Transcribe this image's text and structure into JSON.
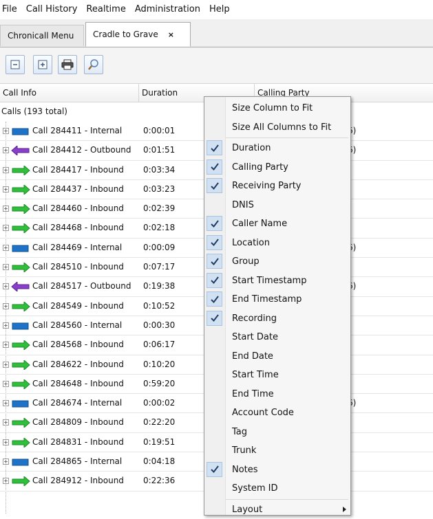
{
  "menubar": [
    "File",
    "Call History",
    "Realtime",
    "Administration",
    "Help"
  ],
  "tabs": [
    {
      "label": "Chronicall Menu",
      "active": false
    },
    {
      "label": "Cradle to Grave",
      "active": true,
      "close": "×"
    }
  ],
  "toolbar": {
    "buttons": [
      "collapse-all-icon",
      "expand-all-icon",
      "print-icon",
      "search-icon"
    ]
  },
  "grid": {
    "columns": [
      "Call Info",
      "Duration",
      "Calling Party"
    ],
    "group_label": "Calls (193 total)",
    "rows": [
      {
        "info": "Call 284411 - Internal",
        "duration": "0:00:01",
        "type": "internal",
        "calling": "6)"
      },
      {
        "info": "Call 284412 - Outbound",
        "duration": "0:01:51",
        "type": "outbound",
        "calling": "6)"
      },
      {
        "info": "Call 284417 - Inbound",
        "duration": "0:03:34",
        "type": "inbound",
        "calling": ""
      },
      {
        "info": "Call 284437 - Inbound",
        "duration": "0:03:23",
        "type": "inbound",
        "calling": ""
      },
      {
        "info": "Call 284460 - Inbound",
        "duration": "0:02:39",
        "type": "inbound",
        "calling": ""
      },
      {
        "info": "Call 284468 - Inbound",
        "duration": "0:02:18",
        "type": "inbound",
        "calling": ""
      },
      {
        "info": "Call 284469 - Internal",
        "duration": "0:00:09",
        "type": "internal",
        "calling": "6)"
      },
      {
        "info": "Call 284510 - Inbound",
        "duration": "0:07:17",
        "type": "inbound",
        "calling": ""
      },
      {
        "info": "Call 284517 - Outbound",
        "duration": "0:19:38",
        "type": "outbound",
        "calling": "6)"
      },
      {
        "info": "Call 284549 - Inbound",
        "duration": "0:10:52",
        "type": "inbound",
        "calling": ""
      },
      {
        "info": "Call 284560 - Internal",
        "duration": "0:00:30",
        "type": "internal",
        "calling": ")"
      },
      {
        "info": "Call 284568 - Inbound",
        "duration": "0:06:17",
        "type": "inbound",
        "calling": ""
      },
      {
        "info": "Call 284622 - Inbound",
        "duration": "0:10:20",
        "type": "inbound",
        "calling": ""
      },
      {
        "info": "Call 284648 - Inbound",
        "duration": "0:59:20",
        "type": "inbound",
        "calling": ""
      },
      {
        "info": "Call 284674 - Internal",
        "duration": "0:00:02",
        "type": "internal",
        "calling": "6)"
      },
      {
        "info": "Call 284809 - Inbound",
        "duration": "0:22:20",
        "type": "inbound",
        "calling": ""
      },
      {
        "info": "Call 284831 - Inbound",
        "duration": "0:19:51",
        "type": "inbound",
        "calling": ""
      },
      {
        "info": "Call 284865 - Internal",
        "duration": "0:04:18",
        "type": "internal",
        "calling": ")"
      },
      {
        "info": "Call 284912 - Inbound",
        "duration": "0:22:36",
        "type": "inbound",
        "calling": ""
      }
    ]
  },
  "context_menu": {
    "items": [
      {
        "label": "Size Column to Fit",
        "checked": false
      },
      {
        "label": "Size All Columns to Fit",
        "checked": false,
        "separator_after": true
      },
      {
        "label": "Duration",
        "checked": true
      },
      {
        "label": "Calling Party",
        "checked": true
      },
      {
        "label": "Receiving Party",
        "checked": true
      },
      {
        "label": "DNIS",
        "checked": false
      },
      {
        "label": "Caller Name",
        "checked": true
      },
      {
        "label": "Location",
        "checked": true
      },
      {
        "label": "Group",
        "checked": true
      },
      {
        "label": "Start Timestamp",
        "checked": true
      },
      {
        "label": "End Timestamp",
        "checked": true
      },
      {
        "label": "Recording",
        "checked": true
      },
      {
        "label": "Start Date",
        "checked": false
      },
      {
        "label": "End Date",
        "checked": false
      },
      {
        "label": "Start Time",
        "checked": false
      },
      {
        "label": "End Time",
        "checked": false
      },
      {
        "label": "Account Code",
        "checked": false
      },
      {
        "label": "Tag",
        "checked": false
      },
      {
        "label": "Trunk",
        "checked": false
      },
      {
        "label": "Notes",
        "checked": true
      },
      {
        "label": "System ID",
        "checked": false,
        "separator_after": true
      },
      {
        "label": "Layout",
        "checked": false,
        "submenu": true
      }
    ]
  },
  "colors": {
    "inbound": "#2fbf3a",
    "outbound": "#8a3fc9",
    "internal": "#1e73c9",
    "check_bg": "#d1e1f1"
  }
}
